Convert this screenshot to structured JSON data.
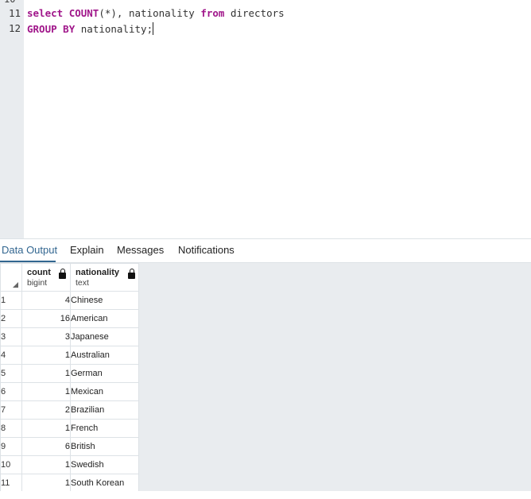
{
  "editor": {
    "gutter_partial": "10",
    "lines": [
      {
        "number": "11",
        "text": "select COUNT(*), nationality from directors"
      },
      {
        "number": "12",
        "text": "GROUP BY nationality;"
      }
    ]
  },
  "tabs": [
    {
      "label": "Data Output",
      "active": true
    },
    {
      "label": "Explain",
      "active": false
    },
    {
      "label": "Messages",
      "active": false
    },
    {
      "label": "Notifications",
      "active": false
    }
  ],
  "grid": {
    "columns": [
      {
        "name": "count",
        "type": "bigint"
      },
      {
        "name": "nationality",
        "type": "text"
      }
    ],
    "rows": [
      {
        "row": "1",
        "count": "4",
        "nationality": "Chinese"
      },
      {
        "row": "2",
        "count": "16",
        "nationality": "American"
      },
      {
        "row": "3",
        "count": "3",
        "nationality": "Japanese"
      },
      {
        "row": "4",
        "count": "1",
        "nationality": "Australian"
      },
      {
        "row": "5",
        "count": "1",
        "nationality": "German"
      },
      {
        "row": "6",
        "count": "1",
        "nationality": "Mexican"
      },
      {
        "row": "7",
        "count": "2",
        "nationality": "Brazilian"
      },
      {
        "row": "8",
        "count": "1",
        "nationality": "French"
      },
      {
        "row": "9",
        "count": "6",
        "nationality": "British"
      },
      {
        "row": "10",
        "count": "1",
        "nationality": "Swedish"
      },
      {
        "row": "11",
        "count": "1",
        "nationality": "South Korean"
      }
    ]
  },
  "icons": {
    "column_lock": "lock-icon",
    "sort_corner": "sort-triangle-icon"
  },
  "colors": {
    "keyword": "#a0168a",
    "active_tab": "#326690",
    "gutter": "#e9ecef"
  }
}
